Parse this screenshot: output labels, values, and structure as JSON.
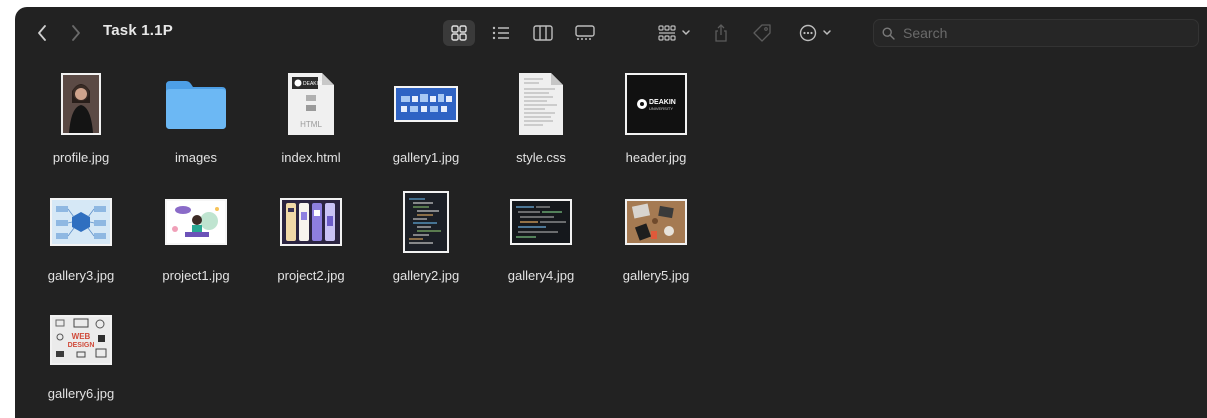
{
  "window": {
    "title": "Task 1.1P"
  },
  "toolbar": {
    "back_icon": "chevron-left-icon",
    "forward_icon": "chevron-right-icon",
    "views": [
      {
        "name": "icon-view",
        "icon": "grid-icon",
        "active": true
      },
      {
        "name": "list-view",
        "icon": "list-icon",
        "active": false
      },
      {
        "name": "column-view",
        "icon": "columns-icon",
        "active": false
      },
      {
        "name": "gallery-view",
        "icon": "gallery-icon",
        "active": false
      }
    ],
    "group_icon": "group-by-icon",
    "share_icon": "share-icon",
    "tag_icon": "tag-icon",
    "more_icon": "ellipsis-circle-icon"
  },
  "search": {
    "placeholder": "Search",
    "value": ""
  },
  "files": [
    {
      "name": "profile.jpg",
      "kind": "photo-portrait"
    },
    {
      "name": "images",
      "kind": "folder"
    },
    {
      "name": "index.html",
      "kind": "html-doc"
    },
    {
      "name": "gallery1.jpg",
      "kind": "image-blue-grid"
    },
    {
      "name": "style.css",
      "kind": "text-doc"
    },
    {
      "name": "header.jpg",
      "kind": "image-logo"
    },
    {
      "name": "gallery3.jpg",
      "kind": "image-diagram"
    },
    {
      "name": "project1.jpg",
      "kind": "image-illustration"
    },
    {
      "name": "project2.jpg",
      "kind": "image-app-screens"
    },
    {
      "name": "gallery2.jpg",
      "kind": "image-code-tall"
    },
    {
      "name": "gallery4.jpg",
      "kind": "image-code-wide"
    },
    {
      "name": "gallery5.jpg",
      "kind": "image-desk-photo"
    },
    {
      "name": "gallery6.jpg",
      "kind": "image-web-design"
    }
  ],
  "thumb_text": {
    "logo": "DEAKIN",
    "logo_sub": "UNIVERSITY",
    "web": "WEB",
    "design": "DESIGN",
    "html": "HTML"
  },
  "colors": {
    "window_bg": "#222222",
    "folder": "#5aacee",
    "text": "#e2e2e2"
  }
}
